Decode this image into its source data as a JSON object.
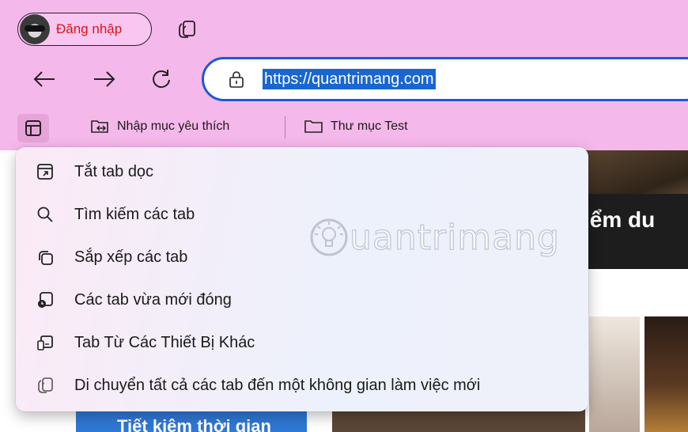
{
  "profile": {
    "label": "Đăng nhập"
  },
  "address_bar": {
    "url": "https://quantrimang.com"
  },
  "favorites_bar": {
    "items": [
      {
        "label": "Nhập mục yêu thích",
        "icon": "import-favorites-icon"
      },
      {
        "label": "Thư mục Test",
        "icon": "folder-icon"
      }
    ]
  },
  "menu": {
    "items": [
      {
        "label": "Tắt tab dọc",
        "icon": "vertical-tabs-off-icon"
      },
      {
        "label": "Tìm kiếm các tab",
        "icon": "search-icon"
      },
      {
        "label": "Sắp xếp các tab",
        "icon": "organize-tabs-icon"
      },
      {
        "label": "Các tab vừa mới đóng",
        "icon": "recently-closed-icon"
      },
      {
        "label": "Tab Từ Các Thiết Bị Khác",
        "icon": "other-devices-icon"
      },
      {
        "label": "Di chuyển tất cả các tab đến một không gian làm việc mới",
        "icon": "workspaces-icon"
      }
    ]
  },
  "page": {
    "headline_fragment": "iểm du",
    "promo_text": "Tiết kiệm thời gian"
  },
  "watermark": {
    "text": "uantrimang"
  },
  "colors": {
    "chrome_bg": "#f5b8ea",
    "address_border": "#1b5ad6",
    "url_selection": "#1966d2",
    "profile_label": "#d3161b"
  }
}
